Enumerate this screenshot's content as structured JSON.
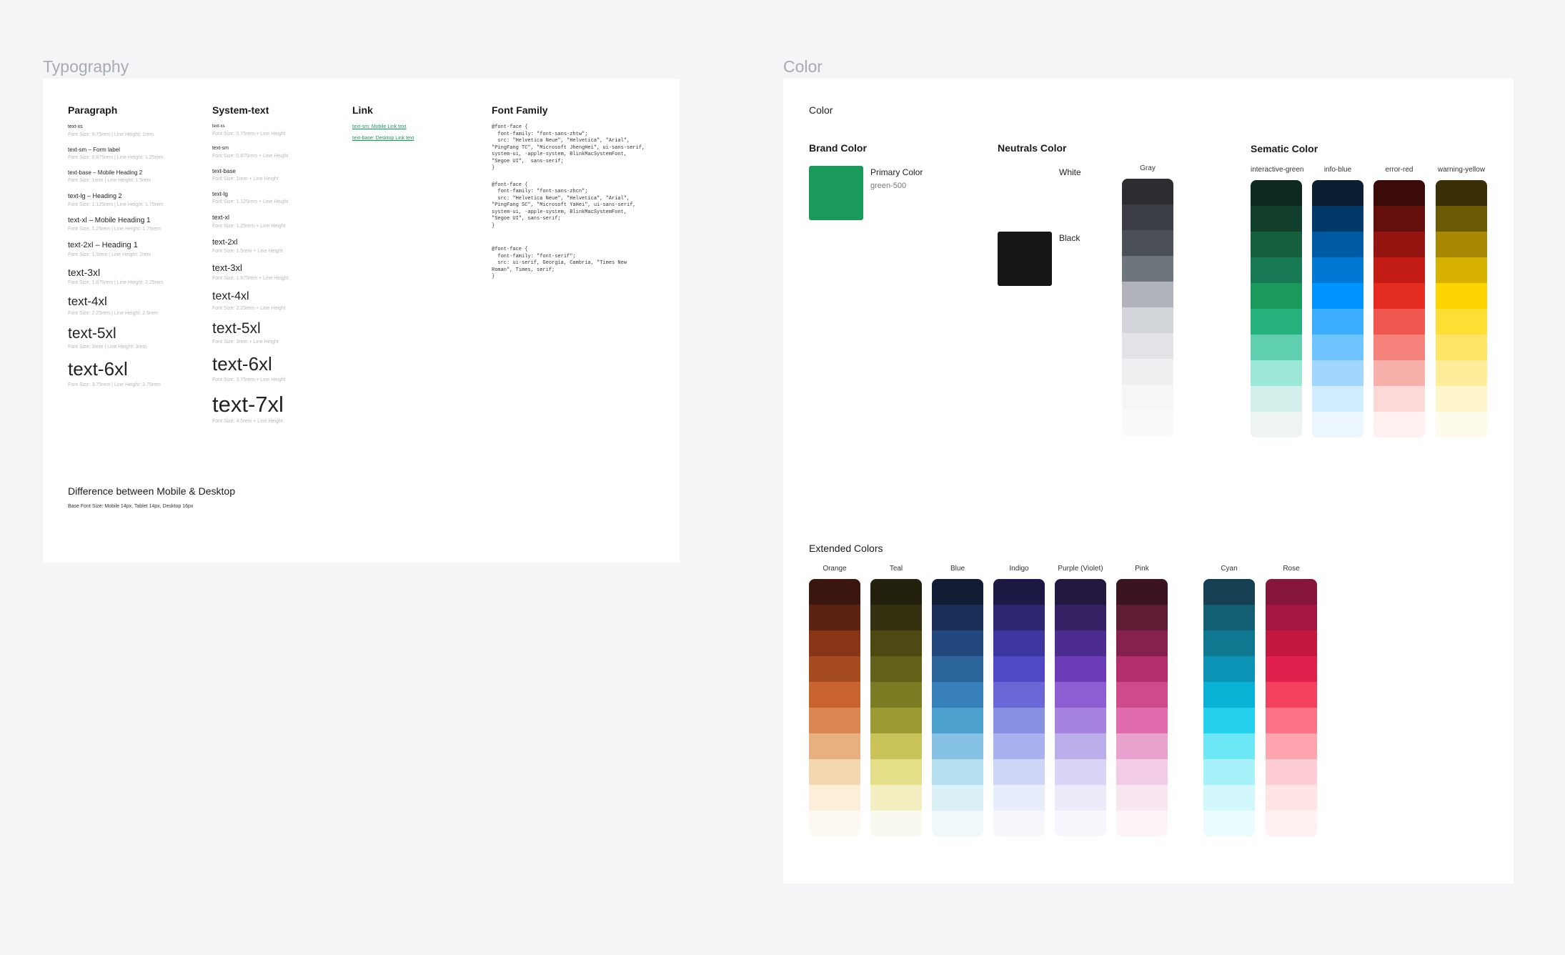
{
  "typography": {
    "section_title": "Typography",
    "paragraph": {
      "heading": "Paragraph",
      "items": [
        {
          "name": "text-xs",
          "meta": "Font Size: 0.75rem | Line Height: 1rem",
          "size": 7
        },
        {
          "name": "text-sm – Form label",
          "meta": "Font Size: 0.875rem | Line Height: 1.25rem",
          "size": 8
        },
        {
          "name": "text-base – Mobile Heading 2",
          "meta": "Font Size: 1rem | Line Height: 1.5rem",
          "size": 8
        },
        {
          "name": "text-lg – Heading 2",
          "meta": "Font Size: 1.125rem | Line Height: 1.75rem",
          "size": 9
        },
        {
          "name": "text-xl – Mobile Heading 1",
          "meta": "Font Size: 1.25rem | Line Height: 1.75rem",
          "size": 10
        },
        {
          "name": "text-2xl – Heading 1",
          "meta": "Font Size: 1.5rem | Line Height: 2rem",
          "size": 11
        },
        {
          "name": "text-3xl",
          "meta": "Font Size: 1.875rem | Line Height: 2.25rem",
          "size": 14
        },
        {
          "name": "text-4xl",
          "meta": "Font Size: 2.25rem | Line Height: 2.5rem",
          "size": 17
        },
        {
          "name": "text-5xl",
          "meta": "Font Size: 3rem | Line Height: 3rem",
          "size": 21
        },
        {
          "name": "text-6xl",
          "meta": "Font Size: 3.75rem | Line Height: 3.75rem",
          "size": 26
        }
      ]
    },
    "system_text": {
      "heading": "System-text",
      "items": [
        {
          "name": "text-xs",
          "meta": "Font Size: 0.75rem + Line Height",
          "size": 6
        },
        {
          "name": "text-sm",
          "meta": "Font Size: 0.875rem + Line Height",
          "size": 7
        },
        {
          "name": "text-base",
          "meta": "Font Size: 1rem + Line Height",
          "size": 8
        },
        {
          "name": "text-lg",
          "meta": "Font Size: 1.125rem + Line Height",
          "size": 8
        },
        {
          "name": "text-xl",
          "meta": "Font Size: 1.25rem + Line Height",
          "size": 9
        },
        {
          "name": "text-2xl",
          "meta": "Font Size: 1.5rem + Line Height",
          "size": 11
        },
        {
          "name": "text-3xl",
          "meta": "Font Size: 1.875rem + Line Height",
          "size": 13
        },
        {
          "name": "text-4xl",
          "meta": "Font Size: 2.25rem + Line Height",
          "size": 16
        },
        {
          "name": "text-5xl",
          "meta": "Font Size: 3rem + Line Height",
          "size": 21
        },
        {
          "name": "text-6xl",
          "meta": "Font Size: 3.75rem + Line Height",
          "size": 26
        },
        {
          "name": "text-7xl",
          "meta": "Font Size: 4.5rem + Line Height",
          "size": 31
        }
      ]
    },
    "link": {
      "heading": "Link",
      "items": [
        "text-sm: Mobile Link text",
        "text-base: Desktop Link text"
      ]
    },
    "font_family": {
      "heading": "Font Family",
      "blocks": [
        "@font-face {\n  font-family: \"font-sans-zhtw\";\n  src: \"Helvetica Neue\", \"Helvetica\", \"Arial\",  \"PingFang TC\", \"Microsoft JhengHei\", ui-sans-serif, system-ui, -apple-system, BlinkMacSystemFont, \"Segoe UI\",  sans-serif;\n}",
        "@font-face {\n  font-family: \"font-sans-zhcn\";\n  src: \"Helvetica Neue\", \"Helvetica\", \"Arial\", \"PingFang SC\", \"Microsoft YaHei\", ui-sans-serif, system-ui, -apple-system, BlinkMacSystemFont, \"Segoe UI\", sans-serif;\n}",
        "@font-face {\n  font-family: \"font-serif\";\n  src: ui-serif, Georgia, Cambria, \"Times New Roman\", Times, serif;\n}"
      ]
    },
    "difference": {
      "heading": "Difference between Mobile & Desktop",
      "text": "Base Font Size: Mobile 14px, Tablet 14px, Desktop 16px"
    }
  },
  "color": {
    "section_title": "Color",
    "card_title": "Color",
    "brand": {
      "heading": "Brand Color",
      "primary_label": "Primary Color",
      "primary_sub": "green-500",
      "primary_hex": "#1a9a5a"
    },
    "neutrals": {
      "heading": "Neutrals Color",
      "white_label": "White",
      "black_label": "Black",
      "black_hex": "#161616",
      "gray_label": "Gray",
      "gray": [
        "#2b2d30",
        "#3b3e44",
        "#4b5058",
        "#6f757d",
        "#b0b4ba",
        "#d1d4d8",
        "#e2e4e7",
        "#eeeff1",
        "#f5f6f7",
        "#fafafb"
      ]
    },
    "semantic": {
      "heading": "Sematic Color",
      "palettes": [
        {
          "name": "interactive-green",
          "shades": [
            "#0c2a1f",
            "#113f2c",
            "#155f3c",
            "#187a55",
            "#1a9a5a",
            "#26b27c",
            "#5fcfb0",
            "#9be8d6",
            "#d2efec",
            "#eef4f2"
          ]
        },
        {
          "name": "info-blue",
          "shades": [
            "#0b1e33",
            "#003869",
            "#005aa3",
            "#0078d4",
            "#0094ff",
            "#3baeff",
            "#6ec4ff",
            "#a1d7ff",
            "#d1ecff",
            "#ebf6ff"
          ]
        },
        {
          "name": "error-red",
          "shades": [
            "#3a0b09",
            "#650f0c",
            "#941510",
            "#c21c14",
            "#e52c20",
            "#f0574e",
            "#f5837b",
            "#f8b0aa",
            "#fcd9d6",
            "#fdf0ef"
          ]
        },
        {
          "name": "warning-yellow",
          "shades": [
            "#3a2f05",
            "#6b5904",
            "#a88803",
            "#d6b100",
            "#ffd500",
            "#ffde33",
            "#ffe566",
            "#ffed99",
            "#fff5cc",
            "#fffbeb"
          ]
        }
      ]
    },
    "extended": {
      "heading": "Extended Colors",
      "palettes": [
        {
          "name": "Orange",
          "shades": [
            "#3b160e",
            "#5c2313",
            "#873417",
            "#a64a1f",
            "#c96430",
            "#db8550",
            "#e9b07f",
            "#f4d6b0",
            "#fbefd9",
            "#fdf9f3"
          ]
        },
        {
          "name": "Teal",
          "shades": [
            "#23200e",
            "#353110",
            "#4c4a12",
            "#63621a",
            "#7b7d24",
            "#9a9b34",
            "#cac35a",
            "#e6df8a",
            "#f4efc0",
            "#faf9ef"
          ]
        },
        {
          "name": "Blue",
          "shades": [
            "#121d35",
            "#1a2e58",
            "#23487e",
            "#2c649c",
            "#3880b9",
            "#4da1cf",
            "#85c2e3",
            "#b5def0",
            "#dcf0f8",
            "#f1f8fb"
          ]
        },
        {
          "name": "Indigo",
          "shades": [
            "#1c1a45",
            "#2c2770",
            "#3d36a0",
            "#5048c4",
            "#6c67d6",
            "#8890e2",
            "#a9b2ee",
            "#cdd6f7",
            "#e8edfc",
            "#f5f7fd"
          ]
        },
        {
          "name": "Purple (Violet)",
          "shades": [
            "#231840",
            "#352264",
            "#4c2d8f",
            "#6a3cb8",
            "#8b5fd2",
            "#a583de",
            "#bcaeea",
            "#d9d4f5",
            "#ecebfa",
            "#f7f6fd"
          ]
        },
        {
          "name": "Pink",
          "shades": [
            "#3c1420",
            "#5e1d35",
            "#86214e",
            "#b32e6c",
            "#cf4a8d",
            "#e06cae",
            "#e9a2ce",
            "#f3cde6",
            "#f8e6f0",
            "#fcf4f8"
          ]
        },
        {
          "name": "Cyan",
          "shades": [
            "#163f52",
            "#125e73",
            "#0e7891",
            "#0a93b5",
            "#0ab3d6",
            "#25d0ec",
            "#6be7f6",
            "#a7f1fa",
            "#d3f8fc",
            "#ecfcfe"
          ]
        },
        {
          "name": "Rose",
          "shades": [
            "#85163a",
            "#a31740",
            "#c4183f",
            "#e01f4c",
            "#f43f5e",
            "#fb7185",
            "#fda4af",
            "#fecdd3",
            "#ffe4e6",
            "#fff1f2"
          ]
        }
      ]
    }
  }
}
